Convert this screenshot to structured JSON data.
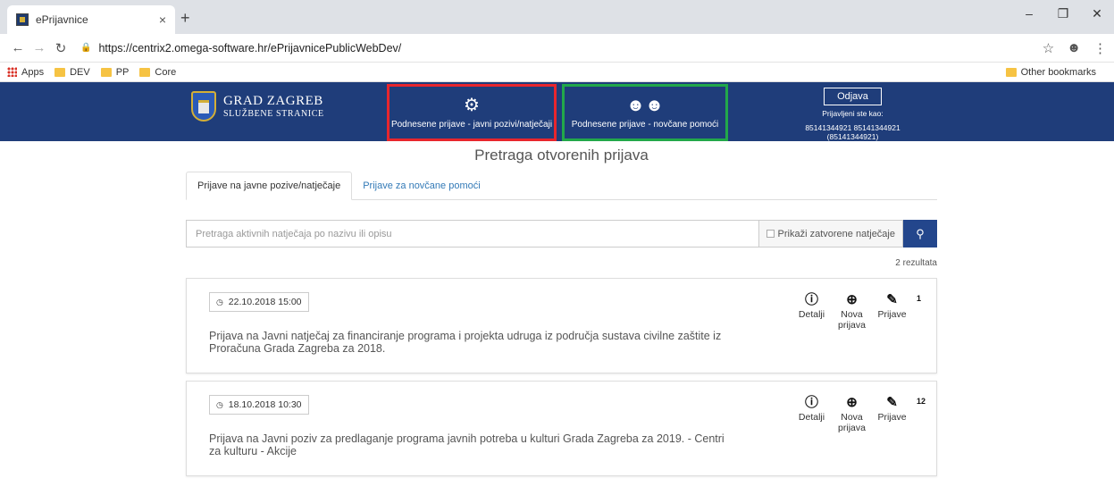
{
  "browser": {
    "tab_title": "ePrijavnice",
    "tab_close": "×",
    "new_tab": "+",
    "url": "https://centrix2.omega-software.hr/ePrijavnicePublicWebDev/",
    "bookmarks": [
      "Apps",
      "DEV",
      "PP",
      "Core"
    ],
    "other_bookmarks": "Other bookmarks"
  },
  "header": {
    "logo_line1": "GRAD ZAGREB",
    "logo_line2": "SLUŽBENE STRANICE",
    "nav_left": "Podnesene prijave - javni pozivi/natječaji",
    "nav_right": "Podnesene prijave - novčane pomoći",
    "logout": "Odjava",
    "logged_as_label": "Prijavljeni ste kao:",
    "logged_as_user": "85141344921 85141344921 (85141344921)",
    "colors": {
      "bar": "#1f3d7a",
      "highlight_left": "#e8262d",
      "highlight_right": "#22a84a"
    }
  },
  "main": {
    "title": "Pretraga otvorenih prijava",
    "tabs": [
      "Prijave na javne pozive/natječaje",
      "Prijave za novčane pomoći"
    ],
    "search_placeholder": "Pretraga aktivnih natječaja po nazivu ili opisu",
    "show_closed": "Prikaži zatvorene natječaje",
    "results": "2 rezultata",
    "action_labels": {
      "details": "Detalji",
      "new_line1": "Nova",
      "new_line2": "prijava",
      "applications": "Prijave"
    },
    "items": [
      {
        "date": "22.10.2018 15:00",
        "text": "Prijava na Javni natječaj za financiranje programa i projekta udruga iz područja sustava civilne zaštite iz Proračuna Grada Zagreba za 2018.",
        "count": "1"
      },
      {
        "date": "18.10.2018 10:30",
        "text": "Prijava na Javni poziv za predlaganje programa javnih potreba u kulturi Grada Zagreba za 2019. - Centri za kulturu - Akcije",
        "count": "12"
      }
    ]
  }
}
